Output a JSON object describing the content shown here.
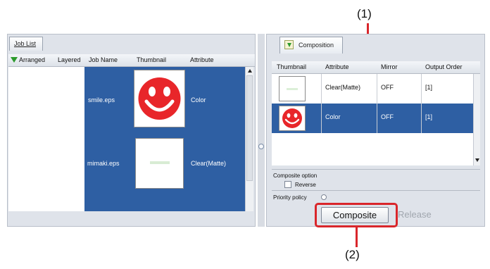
{
  "callouts": {
    "top": "(1)",
    "bottom": "(2)"
  },
  "colors": {
    "selection": "#2e5fa3",
    "callout": "#d9262b",
    "smiley": "#e8262a"
  },
  "job_list": {
    "tab_label": "Job List",
    "columns": {
      "arranged": "Arranged",
      "layered": "Layered",
      "job_name": "Job Name",
      "thumbnail": "Thumbnail",
      "attribute": "Attribute"
    },
    "arranged_icon": "green-down-arrow-icon",
    "rows": [
      {
        "job_name": "smile.eps",
        "attribute": "Color",
        "thumbnail": "red-smiley"
      },
      {
        "job_name": "mimaki.eps",
        "attribute": "Clear(Matte)",
        "thumbnail": "clear-text"
      }
    ]
  },
  "composition": {
    "tab_label": "Composition",
    "columns": {
      "thumbnail": "Thumbnail",
      "attribute": "Attribute",
      "mirror": "Mirror",
      "output_order": "Output Order"
    },
    "rows": [
      {
        "attribute": "Clear(Matte)",
        "mirror": "OFF",
        "output_order": "[1]",
        "selected": false
      },
      {
        "attribute": "Color",
        "mirror": "OFF",
        "output_order": "[1]",
        "selected": true
      }
    ],
    "composite_option_label": "Composite option",
    "reverse_label": "Reverse",
    "priority_policy_label": "Priority policy",
    "composite_button": "Composite",
    "release_button": "Release"
  }
}
